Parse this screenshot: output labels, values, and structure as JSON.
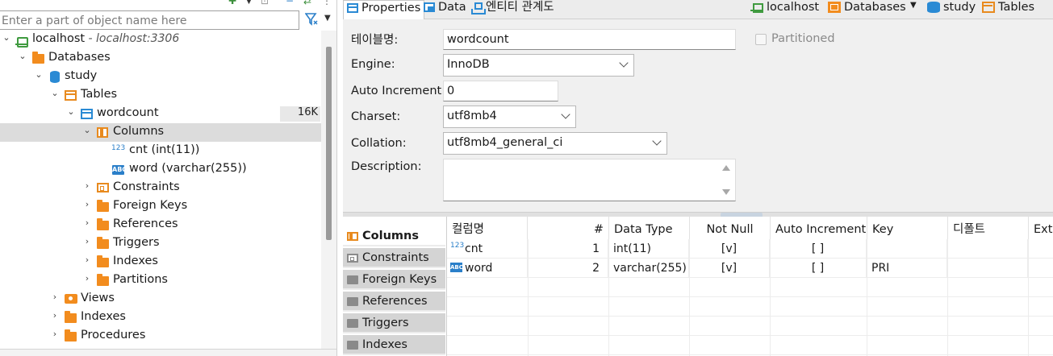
{
  "navigator": {
    "filter_placeholder": "Enter a part of object name here",
    "tree": {
      "connection": {
        "label": "localhost",
        "sub": " - localhost:3306"
      },
      "databases": "Databases",
      "study": "study",
      "tables": "Tables",
      "wordcount": {
        "label": "wordcount",
        "size": "16K"
      },
      "columns": "Columns",
      "col_cnt": "cnt (int(11))",
      "col_word": "word (varchar(255))",
      "constraints": "Constraints",
      "foreign_keys": "Foreign Keys",
      "references": "References",
      "triggers": "Triggers",
      "indexes": "Indexes",
      "partitions": "Partitions",
      "views": "Views",
      "db_indexes": "Indexes",
      "procedures": "Procedures"
    }
  },
  "editor": {
    "tabs": [
      "Properties",
      "Data",
      "엔티티 관계도"
    ],
    "breadcrumb": [
      "localhost",
      "Databases",
      "study",
      "Tables"
    ],
    "form": {
      "table_name_label": "테이블명:",
      "table_name": "wordcount",
      "partitioned_label": "Partitioned",
      "engine_label": "Engine:",
      "engine": "InnoDB",
      "auto_inc_label": "Auto Increment:",
      "auto_inc": "0",
      "charset_label": "Charset:",
      "charset": "utf8mb4",
      "collation_label": "Collation:",
      "collation": "utf8mb4_general_ci",
      "description_label": "Description:",
      "description": ""
    },
    "side_tabs": [
      "Columns",
      "Constraints",
      "Foreign Keys",
      "References",
      "Triggers",
      "Indexes"
    ],
    "grid": {
      "headers": [
        "컬럼명",
        "#",
        "Data Type",
        "Not Null",
        "Auto Increment",
        "Key",
        "디폴트",
        "Extra"
      ],
      "rows": [
        {
          "name": "cnt",
          "icon": "123",
          "num": "1",
          "type": "int(11)",
          "notnull": "[v]",
          "autoinc": "[ ]",
          "key": "",
          "default": "",
          "extra": ""
        },
        {
          "name": "word",
          "icon": "ABC",
          "num": "2",
          "type": "varchar(255)",
          "notnull": "[v]",
          "autoinc": "[ ]",
          "key": "PRI",
          "default": "",
          "extra": ""
        }
      ]
    }
  },
  "colors": {
    "folder": "#f28c1e",
    "accent_blue": "#2a8ad4",
    "connection_green": "#3f9a3f",
    "selection": "#dcdcdc"
  }
}
